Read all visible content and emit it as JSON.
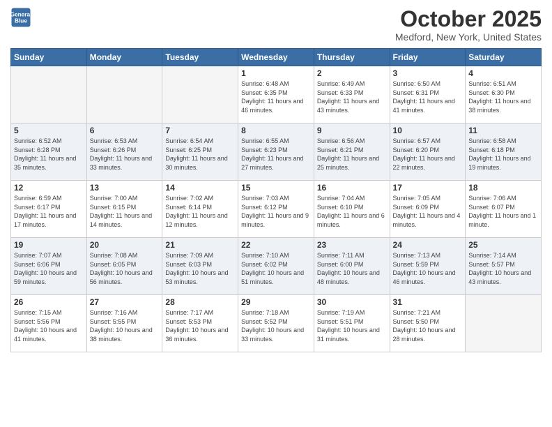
{
  "header": {
    "logo_line1": "General",
    "logo_line2": "Blue",
    "month": "October 2025",
    "location": "Medford, New York, United States"
  },
  "weekdays": [
    "Sunday",
    "Monday",
    "Tuesday",
    "Wednesday",
    "Thursday",
    "Friday",
    "Saturday"
  ],
  "weeks": [
    [
      {
        "day": "",
        "info": ""
      },
      {
        "day": "",
        "info": ""
      },
      {
        "day": "",
        "info": ""
      },
      {
        "day": "1",
        "info": "Sunrise: 6:48 AM\nSunset: 6:35 PM\nDaylight: 11 hours\nand 46 minutes."
      },
      {
        "day": "2",
        "info": "Sunrise: 6:49 AM\nSunset: 6:33 PM\nDaylight: 11 hours\nand 43 minutes."
      },
      {
        "day": "3",
        "info": "Sunrise: 6:50 AM\nSunset: 6:31 PM\nDaylight: 11 hours\nand 41 minutes."
      },
      {
        "day": "4",
        "info": "Sunrise: 6:51 AM\nSunset: 6:30 PM\nDaylight: 11 hours\nand 38 minutes."
      }
    ],
    [
      {
        "day": "5",
        "info": "Sunrise: 6:52 AM\nSunset: 6:28 PM\nDaylight: 11 hours\nand 35 minutes."
      },
      {
        "day": "6",
        "info": "Sunrise: 6:53 AM\nSunset: 6:26 PM\nDaylight: 11 hours\nand 33 minutes."
      },
      {
        "day": "7",
        "info": "Sunrise: 6:54 AM\nSunset: 6:25 PM\nDaylight: 11 hours\nand 30 minutes."
      },
      {
        "day": "8",
        "info": "Sunrise: 6:55 AM\nSunset: 6:23 PM\nDaylight: 11 hours\nand 27 minutes."
      },
      {
        "day": "9",
        "info": "Sunrise: 6:56 AM\nSunset: 6:21 PM\nDaylight: 11 hours\nand 25 minutes."
      },
      {
        "day": "10",
        "info": "Sunrise: 6:57 AM\nSunset: 6:20 PM\nDaylight: 11 hours\nand 22 minutes."
      },
      {
        "day": "11",
        "info": "Sunrise: 6:58 AM\nSunset: 6:18 PM\nDaylight: 11 hours\nand 19 minutes."
      }
    ],
    [
      {
        "day": "12",
        "info": "Sunrise: 6:59 AM\nSunset: 6:17 PM\nDaylight: 11 hours\nand 17 minutes."
      },
      {
        "day": "13",
        "info": "Sunrise: 7:00 AM\nSunset: 6:15 PM\nDaylight: 11 hours\nand 14 minutes."
      },
      {
        "day": "14",
        "info": "Sunrise: 7:02 AM\nSunset: 6:14 PM\nDaylight: 11 hours\nand 12 minutes."
      },
      {
        "day": "15",
        "info": "Sunrise: 7:03 AM\nSunset: 6:12 PM\nDaylight: 11 hours\nand 9 minutes."
      },
      {
        "day": "16",
        "info": "Sunrise: 7:04 AM\nSunset: 6:10 PM\nDaylight: 11 hours\nand 6 minutes."
      },
      {
        "day": "17",
        "info": "Sunrise: 7:05 AM\nSunset: 6:09 PM\nDaylight: 11 hours\nand 4 minutes."
      },
      {
        "day": "18",
        "info": "Sunrise: 7:06 AM\nSunset: 6:07 PM\nDaylight: 11 hours\nand 1 minute."
      }
    ],
    [
      {
        "day": "19",
        "info": "Sunrise: 7:07 AM\nSunset: 6:06 PM\nDaylight: 10 hours\nand 59 minutes."
      },
      {
        "day": "20",
        "info": "Sunrise: 7:08 AM\nSunset: 6:05 PM\nDaylight: 10 hours\nand 56 minutes."
      },
      {
        "day": "21",
        "info": "Sunrise: 7:09 AM\nSunset: 6:03 PM\nDaylight: 10 hours\nand 53 minutes."
      },
      {
        "day": "22",
        "info": "Sunrise: 7:10 AM\nSunset: 6:02 PM\nDaylight: 10 hours\nand 51 minutes."
      },
      {
        "day": "23",
        "info": "Sunrise: 7:11 AM\nSunset: 6:00 PM\nDaylight: 10 hours\nand 48 minutes."
      },
      {
        "day": "24",
        "info": "Sunrise: 7:13 AM\nSunset: 5:59 PM\nDaylight: 10 hours\nand 46 minutes."
      },
      {
        "day": "25",
        "info": "Sunrise: 7:14 AM\nSunset: 5:57 PM\nDaylight: 10 hours\nand 43 minutes."
      }
    ],
    [
      {
        "day": "26",
        "info": "Sunrise: 7:15 AM\nSunset: 5:56 PM\nDaylight: 10 hours\nand 41 minutes."
      },
      {
        "day": "27",
        "info": "Sunrise: 7:16 AM\nSunset: 5:55 PM\nDaylight: 10 hours\nand 38 minutes."
      },
      {
        "day": "28",
        "info": "Sunrise: 7:17 AM\nSunset: 5:53 PM\nDaylight: 10 hours\nand 36 minutes."
      },
      {
        "day": "29",
        "info": "Sunrise: 7:18 AM\nSunset: 5:52 PM\nDaylight: 10 hours\nand 33 minutes."
      },
      {
        "day": "30",
        "info": "Sunrise: 7:19 AM\nSunset: 5:51 PM\nDaylight: 10 hours\nand 31 minutes."
      },
      {
        "day": "31",
        "info": "Sunrise: 7:21 AM\nSunset: 5:50 PM\nDaylight: 10 hours\nand 28 minutes."
      },
      {
        "day": "",
        "info": ""
      }
    ]
  ]
}
